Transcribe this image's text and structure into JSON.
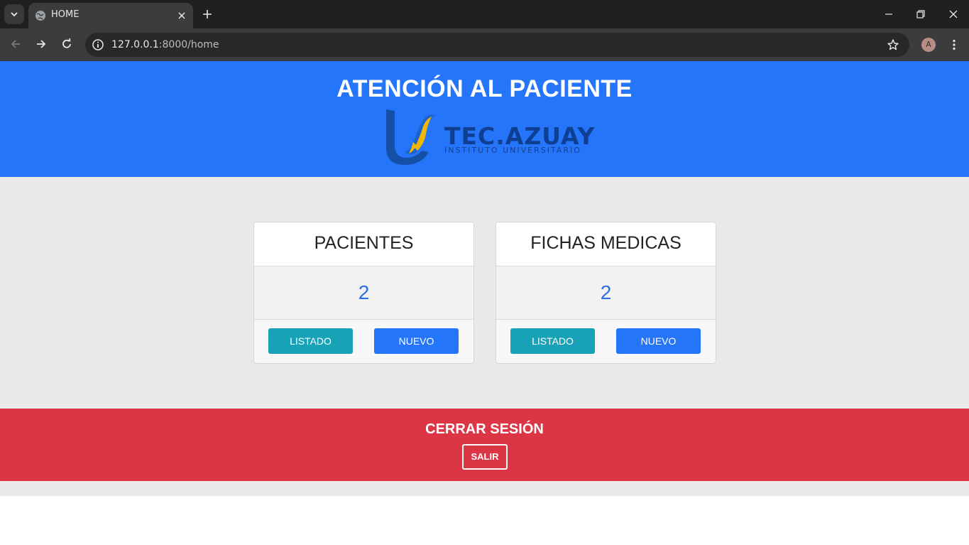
{
  "browser": {
    "tab_title": "HOME",
    "url_host": "127.0.0.1",
    "url_rest": ":8000/home",
    "profile_initial": "A"
  },
  "header": {
    "title": "ATENCIÓN AL PACIENTE",
    "logo_text": "TEC.AZUAY",
    "logo_subtitle": "INSTITUTO UNIVERSITARIO"
  },
  "cards": [
    {
      "title": "PACIENTES",
      "count": "2",
      "list_label": "LISTADO",
      "new_label": "NUEVO"
    },
    {
      "title": "FICHAS MEDICAS",
      "count": "2",
      "list_label": "LISTADO",
      "new_label": "NUEVO"
    }
  ],
  "logout": {
    "title": "CERRAR SESIÓN",
    "button_label": "SALIR"
  },
  "colors": {
    "primary": "#2575fb",
    "info": "#17a2b8",
    "danger": "#dc3545",
    "background": "#e9e9e9"
  }
}
